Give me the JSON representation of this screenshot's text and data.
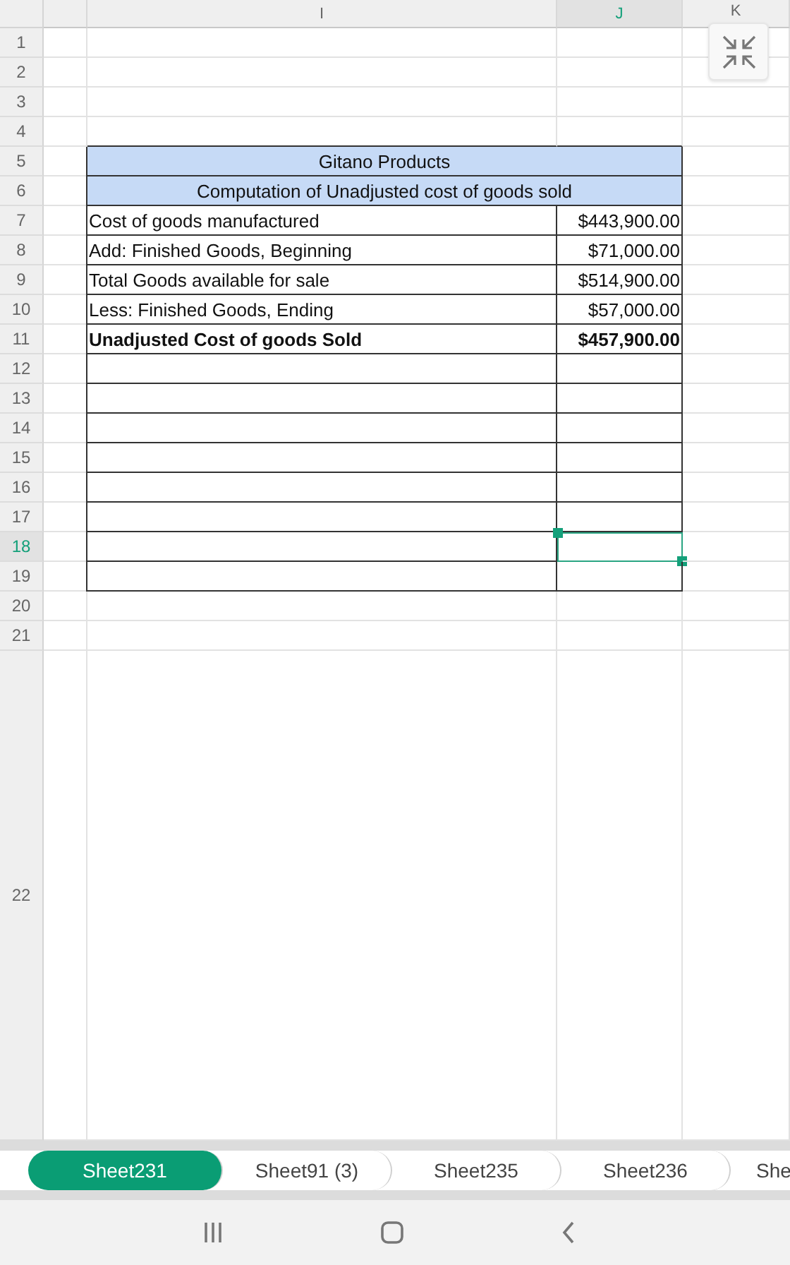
{
  "columns": [
    {
      "selected": false
    },
    {
      "label": "I",
      "selected": false
    },
    {
      "label": "J",
      "selected": true
    },
    {
      "label": "K",
      "selected": false
    }
  ],
  "rows": [
    {
      "number": "1",
      "selected": false,
      "kind": "blank"
    },
    {
      "number": "2",
      "selected": false,
      "kind": "blank"
    },
    {
      "number": "3",
      "selected": false,
      "kind": "blank"
    },
    {
      "number": "4",
      "selected": false,
      "kind": "blank"
    },
    {
      "number": "5",
      "selected": false,
      "kind": "title",
      "text": "Gitano Products"
    },
    {
      "number": "6",
      "selected": false,
      "kind": "title",
      "text": "Computation of Unadjusted cost of goods sold"
    },
    {
      "number": "7",
      "selected": false,
      "kind": "line",
      "label": "Cost of goods manufactured",
      "amount": "$443,900.00",
      "bold": false
    },
    {
      "number": "8",
      "selected": false,
      "kind": "line",
      "label": "Add: Finished Goods, Beginning",
      "amount": "$71,000.00",
      "bold": false
    },
    {
      "number": "9",
      "selected": false,
      "kind": "line",
      "label": "Total Goods available for sale",
      "amount": "$514,900.00",
      "bold": false
    },
    {
      "number": "10",
      "selected": false,
      "kind": "line",
      "label": "Less: Finished Goods, Ending",
      "amount": "$57,000.00",
      "bold": false
    },
    {
      "number": "11",
      "selected": false,
      "kind": "line",
      "label": "Unadjusted Cost of goods Sold",
      "amount": "$457,900.00",
      "bold": true
    },
    {
      "number": "12",
      "selected": false,
      "kind": "boxed"
    },
    {
      "number": "13",
      "selected": false,
      "kind": "boxed"
    },
    {
      "number": "14",
      "selected": false,
      "kind": "boxed"
    },
    {
      "number": "15",
      "selected": false,
      "kind": "boxed"
    },
    {
      "number": "16",
      "selected": false,
      "kind": "boxed"
    },
    {
      "number": "17",
      "selected": false,
      "kind": "boxed"
    },
    {
      "number": "18",
      "selected": true,
      "kind": "boxed"
    },
    {
      "number": "19",
      "selected": false,
      "kind": "boxed"
    },
    {
      "number": "20",
      "selected": false,
      "kind": "blank"
    },
    {
      "number": "21",
      "selected": false,
      "kind": "blank"
    },
    {
      "number": "22",
      "selected": false,
      "kind": "blank"
    }
  ],
  "sheet_tabs": [
    {
      "label": "Sheet231",
      "selected": true
    },
    {
      "label": "Sheet91 (3)",
      "selected": false
    },
    {
      "label": "Sheet235",
      "selected": false
    },
    {
      "label": "Sheet236",
      "selected": false
    },
    {
      "label": "She",
      "selected": false
    }
  ]
}
